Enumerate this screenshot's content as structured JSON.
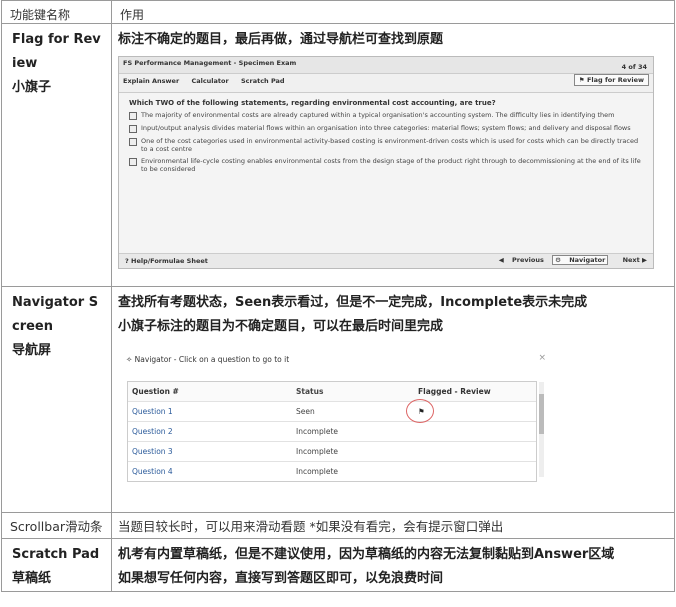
{
  "header": {
    "col1": "功能键名称",
    "col2": "作用"
  },
  "rows": {
    "flag": {
      "name": "Flag for Review",
      "name_cn": "小旗子",
      "desc": "标注不确定的题目，最后再做，通过导航栏可查找到原题"
    },
    "navigator": {
      "name": "Navigator Screen",
      "name_cn": "导航屏",
      "desc1": "查找所有考题状态，Seen表示看过，但是不一定完成，Incomplete表示未完成",
      "desc2": "小旗子标注的题目为不确定题目，可以在最后时间里完成"
    },
    "scrollbar": {
      "name": "Scrollbar滑动条",
      "desc": "当题目较长时，可以用来滑动看题 *如果没有看完，会有提示窗口弹出"
    },
    "scratch": {
      "name": "Scratch Pad",
      "name_cn": "草稿纸",
      "desc1": "机考有内置草稿纸，但是不建议使用，因为草稿纸的内容无法复制黏贴到Answer区域",
      "desc2": "如果想写任何内容，直接写到答题区即可，以免浪费时间"
    }
  },
  "exam_screen": {
    "title": "FS Performance Management - Specimen Exam",
    "counter": "4 of 34",
    "tools": [
      "Explain Answer",
      "Calculator",
      "Scratch Pad"
    ],
    "flag_label": "Flag for Review",
    "question": "Which TWO of the following statements, regarding environmental cost accounting, are true?",
    "options": [
      "The majority of environmental costs are already captured within a typical organisation's accounting system. The difficulty lies in identifying them",
      "Input/output analysis divides material flows within an organisation into three categories: material flows; system flows; and delivery and disposal flows",
      "One of the cost categories used in environmental activity-based costing is environment-driven costs which is used for costs which can be directly traced to a cost centre",
      "Environmental life-cycle costing enables environmental costs from the design stage of the product right through to decommissioning at the end of its life to be considered"
    ],
    "help": "Help/Formulae Sheet",
    "previous": "Previous",
    "navigator": "Navigator",
    "next": "Next"
  },
  "navigator_screen": {
    "title": "Navigator - Click on a question to go to it",
    "columns": [
      "Question #",
      "Status",
      "Flagged - Review"
    ],
    "rows": [
      {
        "q": "Question 1",
        "status": "Seen",
        "flagged": true
      },
      {
        "q": "Question 2",
        "status": "Incomplete",
        "flagged": false
      },
      {
        "q": "Question 3",
        "status": "Incomplete",
        "flagged": false
      },
      {
        "q": "Question 4",
        "status": "Incomplete",
        "flagged": false
      }
    ]
  }
}
